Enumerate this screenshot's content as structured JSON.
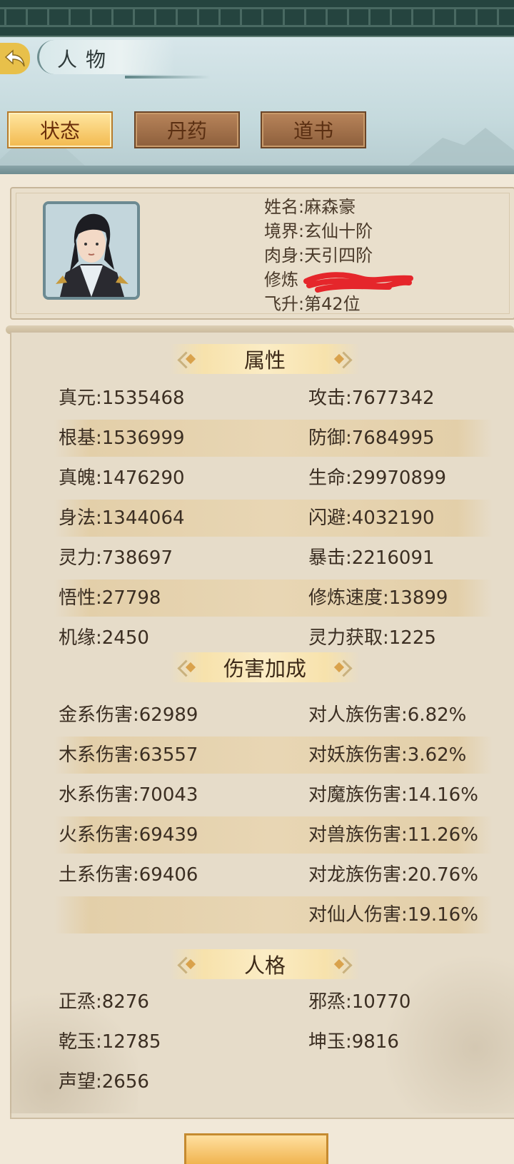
{
  "header": {
    "title": "人物",
    "back_icon": "back-arrow-icon"
  },
  "tabs": [
    {
      "label": "状态",
      "active": true
    },
    {
      "label": "丹药",
      "active": false
    },
    {
      "label": "道书",
      "active": false
    }
  ],
  "profile": {
    "name_line": "姓名:麻森豪",
    "realm_line": "境界:玄仙十阶",
    "body_line": "肉身:天引四阶",
    "cultivation_line": "修炼",
    "ascension_line": "飞升:第42位"
  },
  "sections": {
    "attributes": "属性",
    "damage_bonus": "伤害加成",
    "personality": "人格"
  },
  "attributes": [
    {
      "left": "真元:1535468",
      "right": "攻击:7677342"
    },
    {
      "left": "根基:1536999",
      "right": "防御:7684995"
    },
    {
      "left": "真魄:1476290",
      "right": "生命:29970899"
    },
    {
      "left": "身法:1344064",
      "right": "闪避:4032190"
    },
    {
      "left": "灵力:738697",
      "right": "暴击:2216091"
    },
    {
      "left": "悟性:27798",
      "right": "修炼速度:13899"
    },
    {
      "left": "机缘:2450",
      "right": "灵力获取:1225"
    }
  ],
  "damage": [
    {
      "left": "金系伤害:62989",
      "right": "对人族伤害:6.82%"
    },
    {
      "left": "木系伤害:63557",
      "right": "对妖族伤害:3.62%"
    },
    {
      "left": "水系伤害:70043",
      "right": "对魔族伤害:14.16%"
    },
    {
      "left": "火系伤害:69439",
      "right": "对兽族伤害:11.26%"
    },
    {
      "left": "土系伤害:69406",
      "right": "对龙族伤害:20.76%"
    },
    {
      "left": "",
      "right": "对仙人伤害:19.16%"
    }
  ],
  "personality": [
    {
      "left": "正烝:8276",
      "right": "邪烝:10770"
    },
    {
      "left": "乾玉:12785",
      "right": "坤玉:9816"
    },
    {
      "left": "声望:2656",
      "right": ""
    }
  ],
  "colors": {
    "accent": "#f2b94e",
    "panel": "#e6dcc9",
    "text": "#3b2e22",
    "redaction": "#e5262b"
  }
}
